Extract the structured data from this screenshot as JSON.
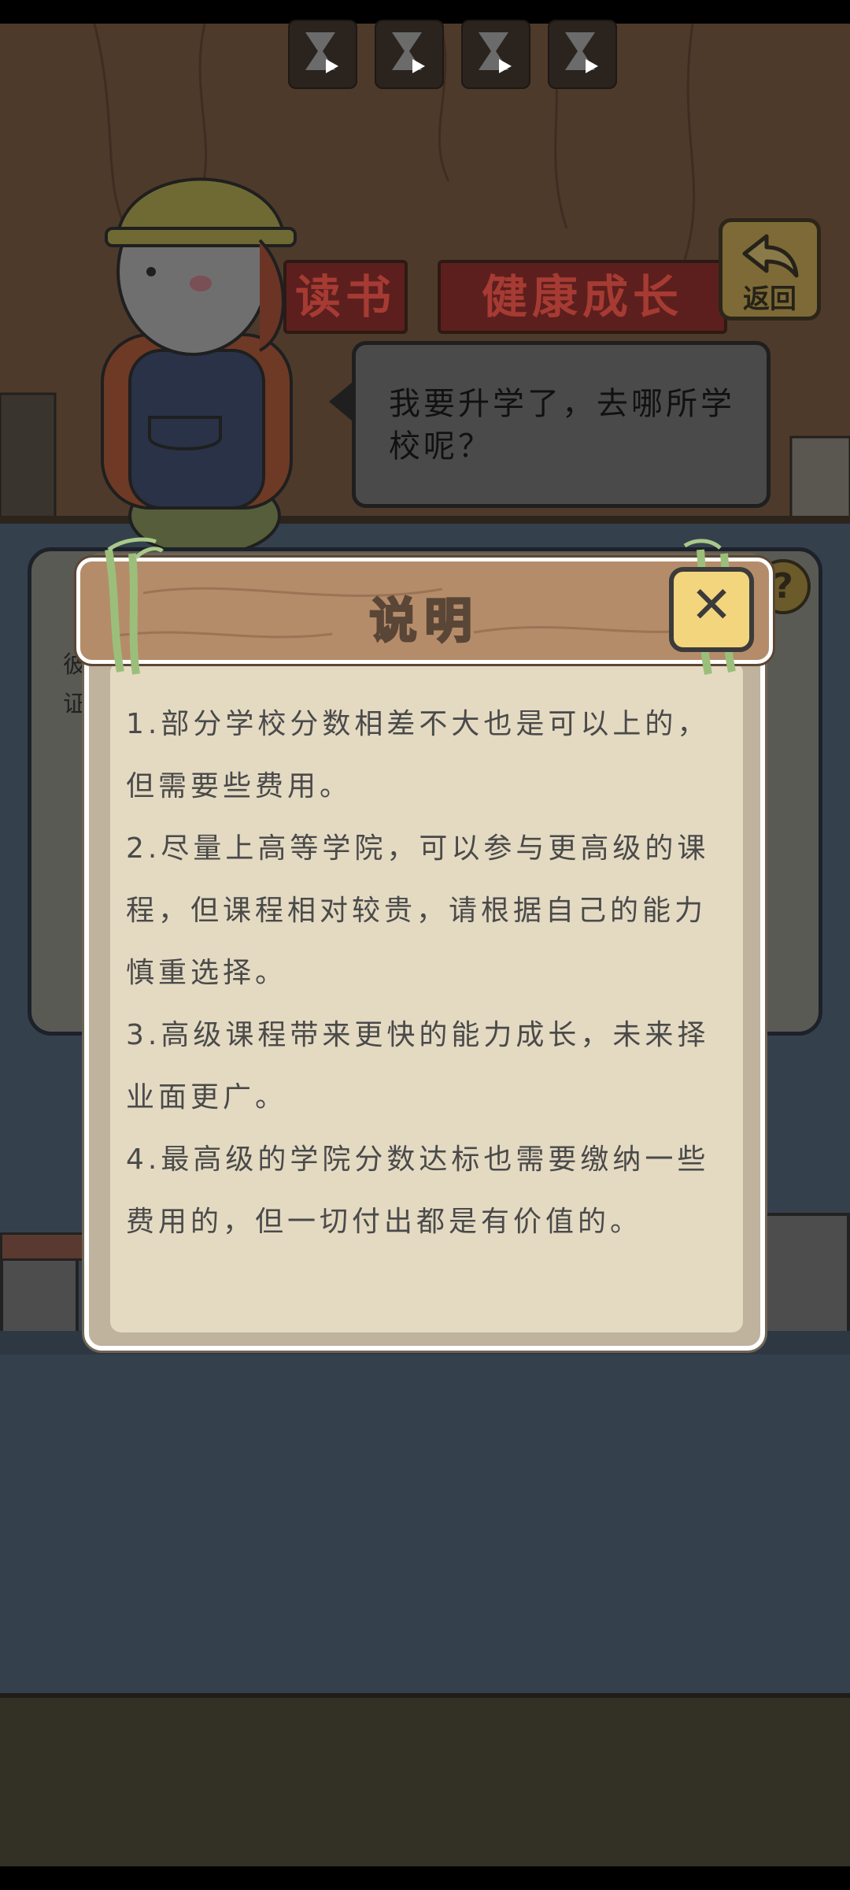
{
  "modal": {
    "title": "说明",
    "paragraphs": [
      "1.部分学校分数相差不大也是可以上的，但需要些费用。",
      "2.尽量上高等学院，可以参与更高级的课程，但课程相对较贵，请根据自己的能力慎重选择。",
      "3.高级课程带来更快的能力成长，未来择业面更广。",
      "4.最高级的学院分数达标也需要缴纳一些费用的，但一切付出都是有价值的。"
    ]
  },
  "scene": {
    "sign_left": "读书",
    "sign_right": "健康成长",
    "return_label": "返回",
    "speech": "我要升学了，去哪所学校呢？",
    "help_symbol": "?",
    "back_text": "彼证"
  },
  "icons": {
    "hourglass": "hourglass-play-icon",
    "close": "close-icon",
    "return": "return-arrow-icon"
  },
  "colors": {
    "modal_header": "#b58c6a",
    "modal_body": "#e4dac2",
    "close_button": "#f3d57d",
    "overlay_bg": "#35404d"
  }
}
